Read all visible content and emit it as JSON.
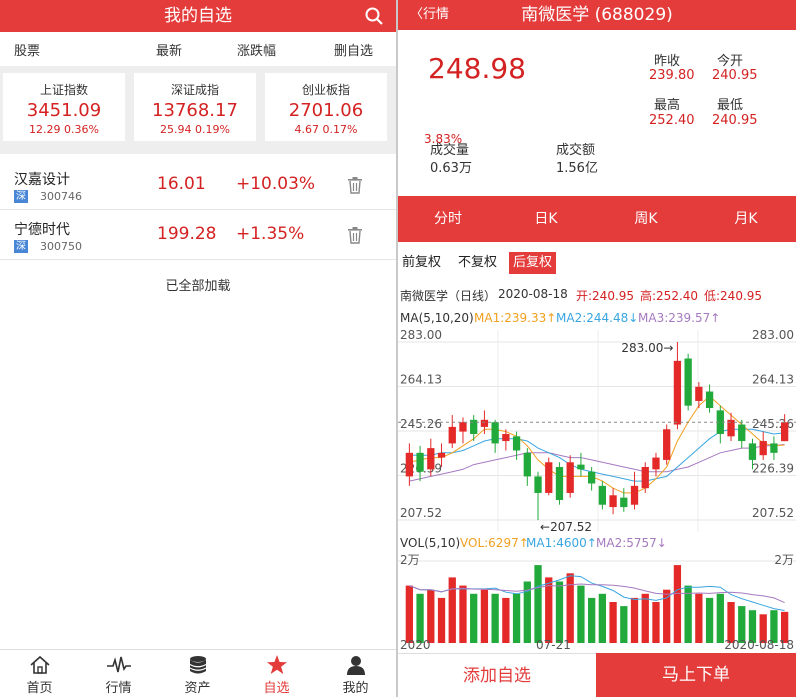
{
  "watchlist": {
    "title": "我的自选",
    "columns": [
      "股票",
      "最新",
      "涨跌幅",
      "删自选"
    ],
    "indices": [
      {
        "name": "上证指数",
        "value": "3451.09",
        "change": "12.29  0.36%"
      },
      {
        "name": "深证成指",
        "value": "13768.17",
        "change": "25.94  0.19%"
      },
      {
        "name": "创业板指",
        "value": "2701.06",
        "change": "4.67  0.17%"
      }
    ],
    "stocks": [
      {
        "name": "汉嘉设计",
        "market": "深",
        "code": "300746",
        "price": "16.01",
        "pct": "+10.03%"
      },
      {
        "name": "宁德时代",
        "market": "深",
        "code": "300750",
        "price": "199.28",
        "pct": "+1.35%"
      }
    ],
    "loaded_text": "已全部加载"
  },
  "tabbar": [
    {
      "label": "首页",
      "icon": "home-icon"
    },
    {
      "label": "行情",
      "icon": "pulse-icon"
    },
    {
      "label": "资产",
      "icon": "database-icon"
    },
    {
      "label": "自选",
      "icon": "star-icon",
      "active": true
    },
    {
      "label": "我的",
      "icon": "user-icon"
    }
  ],
  "detail": {
    "back_label": "行情",
    "title": "南微医学 (688029)",
    "price": "248.98",
    "change_pct": "3.83%",
    "prev_close_label": "昨收",
    "prev_close": "239.80",
    "open_label": "今开",
    "open": "240.95",
    "high_label": "最高",
    "high": "252.40",
    "low_label": "最低",
    "low": "240.95",
    "volume_label": "成交量",
    "volume": "0.63万",
    "turnover_label": "成交额",
    "turnover": "1.56亿",
    "periods": [
      "分时",
      "日K",
      "周K",
      "月K"
    ],
    "active_period": "日K",
    "adjust": [
      "前复权",
      "不复权",
      "后复权"
    ],
    "active_adjust": "后复权",
    "info": {
      "name": "南微医学（日线）",
      "date": "2020-08-18",
      "open": "开:240.95",
      "high": "高:252.40",
      "low": "低:240.95"
    },
    "ma": {
      "label": "MA(5,10,20)",
      "ma1": "MA1:239.33↑",
      "ma2": "MA2:244.48↓",
      "ma3": "MA3:239.57↑"
    },
    "vol": {
      "label": "VOL(5,10)",
      "vol": "VOL:6297↑",
      "ma1": "MA1:4600↑",
      "ma2": "MA2:5757↓"
    },
    "add_label": "添加自选",
    "trade_label": "马上下单"
  },
  "chart_data": {
    "type": "candlestick",
    "y_ticks_left": [
      "283.00",
      "264.13",
      "245.26",
      "226.39",
      "207.52"
    ],
    "y_ticks_right": [
      "283.00",
      "264.13",
      "245.26",
      "226.39",
      "207.52"
    ],
    "ylim": [
      207.52,
      283.0
    ],
    "max_label": "283.00→",
    "min_label": "←207.52",
    "x_labels": [
      "2020",
      "07-21",
      "2020-08-18"
    ],
    "vol_tick": "2万",
    "candles": [
      {
        "o": 226,
        "c": 236,
        "h": 240,
        "l": 222
      },
      {
        "o": 236,
        "c": 228,
        "h": 239,
        "l": 224
      },
      {
        "o": 229,
        "c": 238,
        "h": 242,
        "l": 226
      },
      {
        "o": 234,
        "c": 236,
        "h": 240,
        "l": 230
      },
      {
        "o": 240,
        "c": 247,
        "h": 252,
        "l": 238
      },
      {
        "o": 245,
        "c": 249,
        "h": 251,
        "l": 240
      },
      {
        "o": 250,
        "c": 244,
        "h": 252,
        "l": 241
      },
      {
        "o": 247,
        "c": 250,
        "h": 254,
        "l": 244
      },
      {
        "o": 249,
        "c": 240,
        "h": 250,
        "l": 236
      },
      {
        "o": 241,
        "c": 244,
        "h": 246,
        "l": 237
      },
      {
        "o": 243,
        "c": 237,
        "h": 245,
        "l": 233
      },
      {
        "o": 236,
        "c": 226,
        "h": 238,
        "l": 222
      },
      {
        "o": 226,
        "c": 219,
        "h": 228,
        "l": 207.5
      },
      {
        "o": 219,
        "c": 232,
        "h": 234,
        "l": 218
      },
      {
        "o": 230,
        "c": 216,
        "h": 232,
        "l": 214
      },
      {
        "o": 219,
        "c": 232,
        "h": 235,
        "l": 217
      },
      {
        "o": 231,
        "c": 229,
        "h": 236,
        "l": 226
      },
      {
        "o": 228,
        "c": 223,
        "h": 230,
        "l": 220
      },
      {
        "o": 222,
        "c": 214,
        "h": 224,
        "l": 212
      },
      {
        "o": 213,
        "c": 218,
        "h": 221,
        "l": 210
      },
      {
        "o": 217,
        "c": 213,
        "h": 221,
        "l": 211
      },
      {
        "o": 214,
        "c": 222,
        "h": 228,
        "l": 212
      },
      {
        "o": 221,
        "c": 230,
        "h": 232,
        "l": 219
      },
      {
        "o": 229,
        "c": 234,
        "h": 236,
        "l": 226
      },
      {
        "o": 233,
        "c": 246,
        "h": 248,
        "l": 231
      },
      {
        "o": 248,
        "c": 275,
        "h": 283,
        "l": 246
      },
      {
        "o": 276,
        "c": 256,
        "h": 278,
        "l": 254
      },
      {
        "o": 258,
        "c": 264,
        "h": 266,
        "l": 255
      },
      {
        "o": 262,
        "c": 255,
        "h": 265,
        "l": 253
      },
      {
        "o": 254,
        "c": 244,
        "h": 256,
        "l": 240
      },
      {
        "o": 243,
        "c": 250,
        "h": 253,
        "l": 241
      },
      {
        "o": 248,
        "c": 241,
        "h": 250,
        "l": 238
      },
      {
        "o": 240,
        "c": 233,
        "h": 242,
        "l": 229
      },
      {
        "o": 235,
        "c": 241,
        "h": 245,
        "l": 233
      },
      {
        "o": 240,
        "c": 236,
        "h": 243,
        "l": 233
      },
      {
        "o": 240.95,
        "c": 248.98,
        "h": 252.4,
        "l": 240.95
      }
    ],
    "ma1": [
      232,
      233,
      234,
      234,
      236,
      239,
      242,
      246,
      246,
      245,
      243,
      239,
      233,
      229,
      226,
      226,
      226,
      226,
      224,
      221,
      219,
      219,
      221,
      225,
      230,
      241,
      249,
      256,
      260,
      256,
      252,
      248,
      244,
      240,
      239,
      239.33
    ],
    "ma2": [
      235,
      235,
      235,
      236,
      236,
      237,
      239,
      241,
      242,
      242,
      242,
      241,
      238,
      236,
      234,
      231,
      229,
      228,
      227,
      226,
      225,
      224,
      224,
      225,
      226,
      230,
      234,
      238,
      242,
      245,
      246,
      246,
      246,
      245,
      244,
      244.48
    ],
    "ma3": [
      224,
      225,
      226,
      227,
      228,
      229,
      231,
      232,
      233,
      234,
      235,
      236,
      236,
      236,
      235,
      234,
      234,
      233,
      232,
      231,
      230,
      229,
      228,
      228,
      228,
      229,
      230,
      232,
      234,
      236,
      237,
      238,
      238,
      239,
      239,
      239.57
    ],
    "volumes": [
      0.7,
      0.6,
      0.65,
      0.55,
      0.8,
      0.7,
      0.6,
      0.65,
      0.6,
      0.55,
      0.6,
      0.75,
      0.95,
      0.8,
      0.75,
      0.85,
      0.7,
      0.55,
      0.6,
      0.5,
      0.45,
      0.55,
      0.6,
      0.5,
      0.65,
      0.95,
      0.7,
      0.6,
      0.55,
      0.6,
      0.5,
      0.45,
      0.4,
      0.35,
      0.4,
      0.38
    ],
    "colors": {
      "up": "#e42929",
      "down": "#22a93b",
      "ma1": "#f0a020",
      "ma2": "#3aa6e0",
      "ma3": "#a67ac0"
    }
  }
}
